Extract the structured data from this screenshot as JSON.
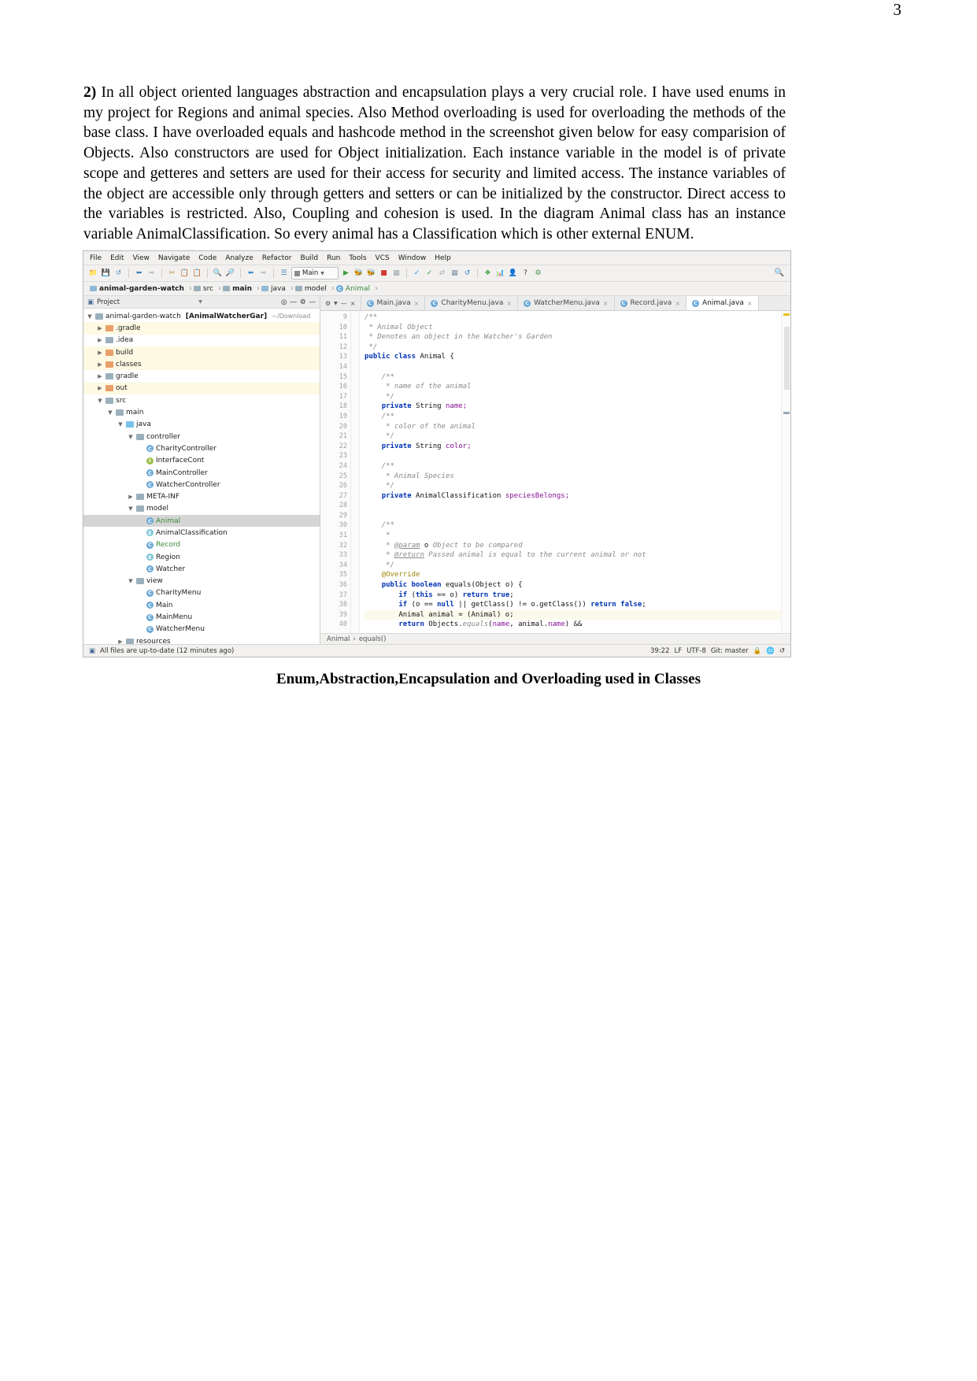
{
  "page": {
    "number": "3"
  },
  "document": {
    "paragraph_marker": "2)",
    "paragraph_text": " In all object oriented languages abstraction and encapsulation plays a very crucial role. I have used enums in my project for Regions and animal species. Also Method overloading is used for overloading the methods of the base class. I have overloaded equals and hashcode method in the screenshot given below for easy comparision of Objects. Also constructors are used for Object initialization. Each instance variable in the model is of private scope and getteres and setters are used for their access for security and limited access. The instance variables of the object are accessible only through getters and setters or can be initialized by the constructor. Direct access to the variables is restricted. Also, Coupling and cohesion is used. In the diagram Animal class has an instance variable AnimalClassification. So every animal has a Classification which is other external ENUM.",
    "figure_caption": "Enum,Abstraction,Encapsulation and Overloading used in Classes"
  },
  "ide": {
    "menubar": [
      "File",
      "Edit",
      "View",
      "Navigate",
      "Code",
      "Analyze",
      "Refactor",
      "Build",
      "Run",
      "Tools",
      "VCS",
      "Window",
      "Help"
    ],
    "toolbar": {
      "icons": [
        "open-folder-icon",
        "save-icon",
        "sync-icon",
        "undo-icon",
        "redo-icon",
        "cut-icon",
        "copy-icon",
        "paste-icon",
        "find-icon",
        "replace-icon",
        "back-icon",
        "forward-icon",
        "compile-icon"
      ],
      "run_config": "Main",
      "run_icons": [
        "run-icon",
        "debug-icon",
        "run-coverage-icon",
        "stop-icon",
        "profile-icon"
      ],
      "vcs_icons": [
        "update-project-icon",
        "commit-icon",
        "diff-icon",
        "rollback-icon",
        "revert-icon"
      ],
      "right_icons": [
        "structure-icon",
        "database-icon",
        "person-icon",
        "help-icon",
        "settings-icon"
      ],
      "search_icon": "search-icon"
    },
    "breadcrumb": [
      {
        "label": "animal-garden-watch",
        "icon": "module-icon",
        "bold": true
      },
      {
        "label": "src",
        "icon": "folder-icon",
        "bold": false
      },
      {
        "label": "main",
        "icon": "source-folder-icon",
        "bold": true
      },
      {
        "label": "java",
        "icon": "java-folder-icon",
        "bold": false
      },
      {
        "label": "model",
        "icon": "package-icon",
        "bold": false
      },
      {
        "label": "Animal",
        "icon": "class-icon",
        "bold": false
      }
    ],
    "project_pane": {
      "title": "Project",
      "dropdown_icon": "chevron-down-icon",
      "actions": [
        "target-icon",
        "collapse-all-icon",
        "settings-icon",
        "hide-icon"
      ],
      "tree": [
        {
          "depth": 0,
          "arrow": "open",
          "icon": "module",
          "label": "animal-garden-watch",
          "bold_suffix": "[AnimalWatcherGar]",
          "path": "~/Download",
          "highlight": "none"
        },
        {
          "depth": 1,
          "arrow": "closed",
          "icon": "orange",
          "label": ".gradle",
          "highlight": "yellow"
        },
        {
          "depth": 1,
          "arrow": "closed",
          "icon": "grey",
          "label": ".idea",
          "highlight": "none"
        },
        {
          "depth": 1,
          "arrow": "closed",
          "icon": "orange",
          "label": "build",
          "highlight": "yellow"
        },
        {
          "depth": 1,
          "arrow": "closed",
          "icon": "orange",
          "label": "classes",
          "highlight": "yellow"
        },
        {
          "depth": 1,
          "arrow": "closed",
          "icon": "grey",
          "label": "gradle",
          "highlight": "none"
        },
        {
          "depth": 1,
          "arrow": "closed",
          "icon": "orange",
          "label": "out",
          "highlight": "yellow"
        },
        {
          "depth": 1,
          "arrow": "open",
          "icon": "grey",
          "label": "src",
          "highlight": "none"
        },
        {
          "depth": 2,
          "arrow": "open",
          "icon": "src",
          "label": "main",
          "highlight": "none"
        },
        {
          "depth": 3,
          "arrow": "open",
          "icon": "blue",
          "label": "java",
          "highlight": "none"
        },
        {
          "depth": 4,
          "arrow": "open",
          "icon": "grey",
          "label": "controller",
          "highlight": "none"
        },
        {
          "depth": 5,
          "arrow": "none",
          "icon": "class",
          "label": "CharityController",
          "highlight": "none"
        },
        {
          "depth": 5,
          "arrow": "none",
          "icon": "interface",
          "label": "InterfaceCont",
          "highlight": "none"
        },
        {
          "depth": 5,
          "arrow": "none",
          "icon": "class",
          "label": "MainController",
          "highlight": "none"
        },
        {
          "depth": 5,
          "arrow": "none",
          "icon": "class",
          "label": "WatcherController",
          "highlight": "none"
        },
        {
          "depth": 4,
          "arrow": "closed",
          "icon": "grey",
          "label": "META-INF",
          "highlight": "none"
        },
        {
          "depth": 4,
          "arrow": "open",
          "icon": "grey",
          "label": "model",
          "highlight": "none"
        },
        {
          "depth": 5,
          "arrow": "none",
          "icon": "class",
          "label": "Animal",
          "highlight": "selected",
          "green": true
        },
        {
          "depth": 5,
          "arrow": "none",
          "icon": "enum",
          "label": "AnimalClassification",
          "highlight": "none"
        },
        {
          "depth": 5,
          "arrow": "none",
          "icon": "class",
          "label": "Record",
          "highlight": "none",
          "green": true
        },
        {
          "depth": 5,
          "arrow": "none",
          "icon": "enum",
          "label": "Region",
          "highlight": "none"
        },
        {
          "depth": 5,
          "arrow": "none",
          "icon": "class",
          "label": "Watcher",
          "highlight": "none"
        },
        {
          "depth": 4,
          "arrow": "open",
          "icon": "grey",
          "label": "view",
          "highlight": "none"
        },
        {
          "depth": 5,
          "arrow": "none",
          "icon": "class",
          "label": "CharityMenu",
          "highlight": "none"
        },
        {
          "depth": 5,
          "arrow": "none",
          "icon": "class",
          "label": "Main",
          "highlight": "none"
        },
        {
          "depth": 5,
          "arrow": "none",
          "icon": "class",
          "label": "MainMenu",
          "highlight": "none"
        },
        {
          "depth": 5,
          "arrow": "none",
          "icon": "class",
          "label": "WatcherMenu",
          "highlight": "none"
        },
        {
          "depth": 3,
          "arrow": "closed",
          "icon": "grey",
          "label": "resources",
          "highlight": "none"
        }
      ]
    },
    "editor_tabs": [
      {
        "label": "Main.java",
        "active": false
      },
      {
        "label": "CharityMenu.java",
        "active": false
      },
      {
        "label": "WatcherMenu.java",
        "active": false
      },
      {
        "label": "Record.java",
        "active": false
      },
      {
        "label": "Animal.java",
        "active": true
      }
    ],
    "code": {
      "first_line": 9,
      "lines": [
        {
          "n": 9,
          "segs": [
            {
              "t": "/**",
              "c": "cm"
            }
          ],
          "indent": 0
        },
        {
          "n": 10,
          "segs": [
            {
              "t": " * Animal Object",
              "c": "cm"
            }
          ],
          "indent": 0
        },
        {
          "n": 11,
          "segs": [
            {
              "t": " * Denotes an object in the Watcher's Garden",
              "c": "cm"
            }
          ],
          "indent": 0
        },
        {
          "n": 12,
          "segs": [
            {
              "t": " */",
              "c": "cm"
            }
          ],
          "indent": 0
        },
        {
          "n": 13,
          "segs": [
            {
              "t": "public class ",
              "c": "kw"
            },
            {
              "t": "Animal {",
              "c": "ty"
            }
          ],
          "indent": 0
        },
        {
          "n": 14,
          "segs": [],
          "indent": 0
        },
        {
          "n": 15,
          "segs": [
            {
              "t": "    /**",
              "c": "cm"
            }
          ],
          "indent": 0
        },
        {
          "n": 16,
          "segs": [
            {
              "t": "     * name of the animal",
              "c": "cm"
            }
          ],
          "indent": 0
        },
        {
          "n": 17,
          "segs": [
            {
              "t": "     */",
              "c": "cm"
            }
          ],
          "indent": 0
        },
        {
          "n": 18,
          "segs": [
            {
              "t": "    ",
              "c": "ty"
            },
            {
              "t": "private ",
              "c": "kw"
            },
            {
              "t": "String ",
              "c": "ty"
            },
            {
              "t": "name;",
              "c": "fld"
            }
          ],
          "indent": 0
        },
        {
          "n": 19,
          "segs": [
            {
              "t": "    /**",
              "c": "cm"
            }
          ],
          "indent": 0
        },
        {
          "n": 20,
          "segs": [
            {
              "t": "     * color of the animal",
              "c": "cm"
            }
          ],
          "indent": 0
        },
        {
          "n": 21,
          "segs": [
            {
              "t": "     */",
              "c": "cm"
            }
          ],
          "indent": 0
        },
        {
          "n": 22,
          "segs": [
            {
              "t": "    ",
              "c": "ty"
            },
            {
              "t": "private ",
              "c": "kw"
            },
            {
              "t": "String ",
              "c": "ty"
            },
            {
              "t": "color;",
              "c": "fld"
            }
          ],
          "indent": 0
        },
        {
          "n": 23,
          "segs": [],
          "indent": 0
        },
        {
          "n": 24,
          "segs": [
            {
              "t": "    /**",
              "c": "cm"
            }
          ],
          "indent": 0
        },
        {
          "n": 25,
          "segs": [
            {
              "t": "     * Animal Species",
              "c": "cm"
            }
          ],
          "indent": 0
        },
        {
          "n": 26,
          "segs": [
            {
              "t": "     */",
              "c": "cm"
            }
          ],
          "indent": 0
        },
        {
          "n": 27,
          "segs": [
            {
              "t": "    ",
              "c": "ty"
            },
            {
              "t": "private ",
              "c": "kw"
            },
            {
              "t": "AnimalClassification ",
              "c": "ty"
            },
            {
              "t": "speciesBelongs;",
              "c": "fld"
            }
          ],
          "indent": 0
        },
        {
          "n": 28,
          "segs": [],
          "indent": 0
        },
        {
          "n": 29,
          "segs": [],
          "indent": 0
        },
        {
          "n": 30,
          "segs": [
            {
              "t": "    /**",
              "c": "cm"
            }
          ],
          "indent": 0
        },
        {
          "n": 31,
          "segs": [
            {
              "t": "     *",
              "c": "cm"
            }
          ],
          "indent": 0
        },
        {
          "n": 32,
          "segs": [
            {
              "t": "     * ",
              "c": "cm"
            },
            {
              "t": "@param",
              "c": "tag"
            },
            {
              "t": " o ",
              "c": "ty"
            },
            {
              "t": "Object to be compared",
              "c": "cm"
            }
          ],
          "indent": 0
        },
        {
          "n": 33,
          "segs": [
            {
              "t": "     * ",
              "c": "cm"
            },
            {
              "t": "@return",
              "c": "tag"
            },
            {
              "t": " Passed animal is equal to the current animal or not",
              "c": "cm"
            }
          ],
          "indent": 0
        },
        {
          "n": 34,
          "segs": [
            {
              "t": "     */",
              "c": "cm"
            }
          ],
          "indent": 0
        },
        {
          "n": 35,
          "segs": [
            {
              "t": "    @Override",
              "c": "an"
            }
          ],
          "indent": 0
        },
        {
          "n": 36,
          "segs": [
            {
              "t": "    ",
              "c": "ty"
            },
            {
              "t": "public boolean ",
              "c": "kw"
            },
            {
              "t": "equals(Object o) {",
              "c": "ty"
            }
          ],
          "indent": 0,
          "gutter_icon": "override-icon"
        },
        {
          "n": 37,
          "segs": [
            {
              "t": "        ",
              "c": "ty"
            },
            {
              "t": "if ",
              "c": "kw"
            },
            {
              "t": "(",
              "c": "ty"
            },
            {
              "t": "this ",
              "c": "kw"
            },
            {
              "t": "== o) ",
              "c": "ty"
            },
            {
              "t": "return true",
              "c": "kw"
            },
            {
              "t": ";",
              "c": "ty"
            }
          ],
          "indent": 0
        },
        {
          "n": 38,
          "segs": [
            {
              "t": "        ",
              "c": "ty"
            },
            {
              "t": "if ",
              "c": "kw"
            },
            {
              "t": "(o == ",
              "c": "ty"
            },
            {
              "t": "null ",
              "c": "kw"
            },
            {
              "t": "|| getClass() != o.getClass()) ",
              "c": "ty"
            },
            {
              "t": "return false",
              "c": "kw"
            },
            {
              "t": ";",
              "c": "ty"
            }
          ],
          "indent": 0
        },
        {
          "n": 39,
          "segs": [
            {
              "t": "        Animal animal = (Animal) o;",
              "c": "ty"
            }
          ],
          "indent": 0,
          "highlight": true,
          "gutter_icon": "bulb-icon"
        },
        {
          "n": 40,
          "segs": [
            {
              "t": "        ",
              "c": "ty"
            },
            {
              "t": "return ",
              "c": "kw"
            },
            {
              "t": "Objects.",
              "c": "ty"
            },
            {
              "t": "equals",
              "c": "cm"
            },
            {
              "t": "(",
              "c": "ty"
            },
            {
              "t": "name",
              "c": "fld"
            },
            {
              "t": ", animal.",
              "c": "ty"
            },
            {
              "t": "name",
              "c": "fld"
            },
            {
              "t": ") &&",
              "c": "ty"
            }
          ],
          "indent": 0
        }
      ]
    },
    "editor_breadcrumb": [
      "Animal",
      "equals()"
    ],
    "status_bar": {
      "vcs_status": "All files are up-to-date (12 minutes ago)",
      "caret": "39:22",
      "line_separator": "LF",
      "encoding": "UTF-8",
      "branch": "Git: master",
      "icons": [
        "lock-icon",
        "globe-icon",
        "event-log-icon"
      ]
    }
  }
}
